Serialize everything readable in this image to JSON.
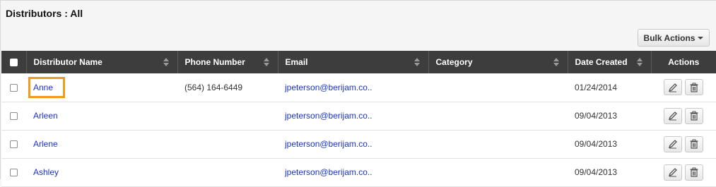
{
  "page": {
    "title": "Distributors : All"
  },
  "toolbar": {
    "bulk_actions_label": "Bulk Actions"
  },
  "table": {
    "columns": [
      {
        "label": "Distributor Name",
        "sortable": true
      },
      {
        "label": "Phone Number",
        "sortable": true
      },
      {
        "label": "Email",
        "sortable": true
      },
      {
        "label": "Category",
        "sortable": true
      },
      {
        "label": "Date Created",
        "sortable": true
      },
      {
        "label": "Actions",
        "sortable": false
      }
    ],
    "rows": [
      {
        "name": "Anne",
        "phone": "(564) 164-6449",
        "email": "jpeterson@berijam.co..",
        "category": "",
        "date_created": "01/24/2014"
      },
      {
        "name": "Arleen",
        "phone": "",
        "email": "jpeterson@berijam.co..",
        "category": "",
        "date_created": "09/04/2013"
      },
      {
        "name": "Arlene",
        "phone": "",
        "email": "jpeterson@berijam.co..",
        "category": "",
        "date_created": "09/04/2013"
      },
      {
        "name": "Ashley",
        "phone": "",
        "email": "jpeterson@berijam.co..",
        "category": "",
        "date_created": "09/04/2013"
      }
    ]
  },
  "icons": {
    "edit": "pencil-icon",
    "delete": "trash-icon",
    "sort": "sort-arrows-icon",
    "dropdown": "caret-down-icon"
  },
  "colors": {
    "header_bg": "#3d3d3d",
    "link": "#1a35c0",
    "highlight": "#f29a1f"
  }
}
